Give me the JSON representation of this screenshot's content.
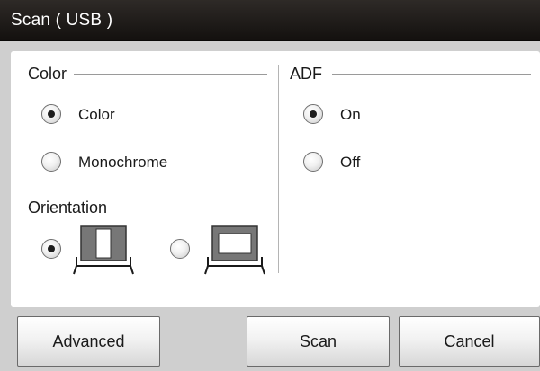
{
  "window": {
    "title": "Scan ( USB )"
  },
  "color_group": {
    "label": "Color",
    "options": [
      {
        "label": "Color",
        "selected": true
      },
      {
        "label": "Monochrome",
        "selected": false
      }
    ]
  },
  "orientation_group": {
    "label": "Orientation",
    "options": [
      {
        "icon": "portrait-orientation-icon",
        "selected": true
      },
      {
        "icon": "landscape-orientation-icon",
        "selected": false
      }
    ]
  },
  "adf_group": {
    "label": "ADF",
    "options": [
      {
        "label": "On",
        "selected": true
      },
      {
        "label": "Off",
        "selected": false
      }
    ]
  },
  "buttons": {
    "advanced": "Advanced",
    "scan": "Scan",
    "cancel": "Cancel"
  },
  "colors": {
    "titlebar": "#1f1b19",
    "frame": "#8e8e8e",
    "panel": "#ffffff",
    "button_face": "#f0f0f0"
  }
}
